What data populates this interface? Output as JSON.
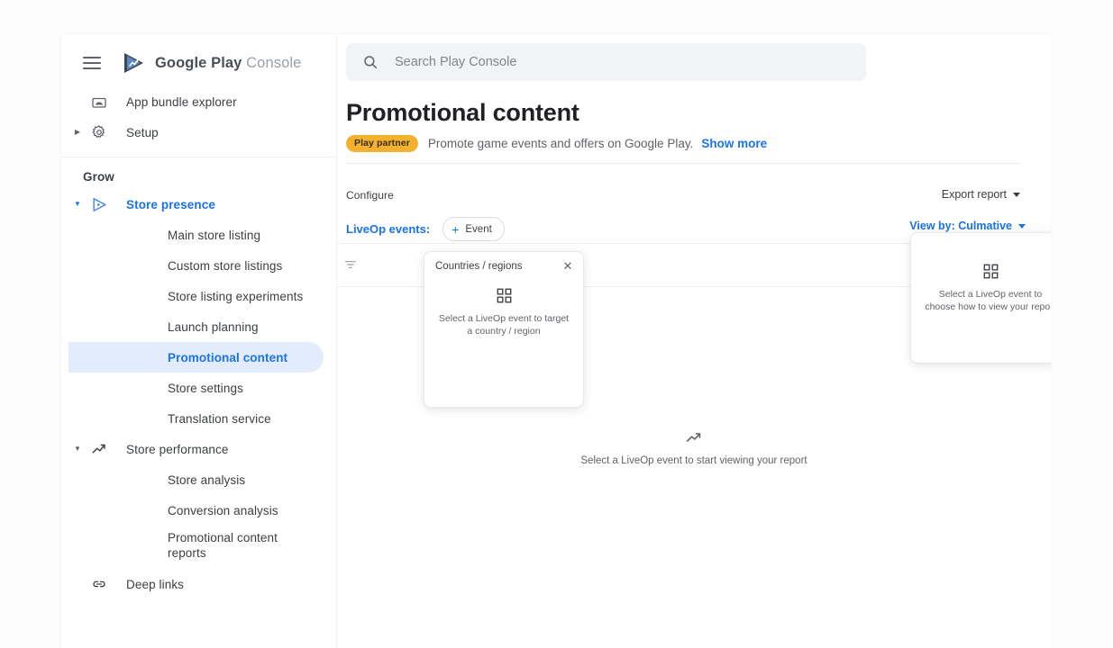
{
  "brand": {
    "name_bold": "Google Play",
    "name_light": "Console",
    "logo_icon": "google-play-console-logo",
    "menu_icon": "hamburger-menu-icon"
  },
  "sidebar": {
    "top_items": [
      {
        "label": "App bundle explorer",
        "icon": "app-bundle-icon",
        "expandable": false
      },
      {
        "label": "Setup",
        "icon": "gear-icon",
        "expandable": true
      }
    ],
    "section_label": "Grow",
    "groups": [
      {
        "label": "Store presence",
        "icon": "play-triangle-icon",
        "expanded": true,
        "highlighted": true,
        "children": [
          {
            "label": "Main store listing",
            "active": false
          },
          {
            "label": "Custom store listings",
            "active": false
          },
          {
            "label": "Store listing experiments",
            "active": false
          },
          {
            "label": "Launch planning",
            "active": false
          },
          {
            "label": "Promotional content",
            "active": true
          },
          {
            "label": "Store settings",
            "active": false
          },
          {
            "label": "Translation service",
            "active": false
          }
        ]
      },
      {
        "label": "Store performance",
        "icon": "trending-up-icon",
        "expanded": true,
        "highlighted": false,
        "children": [
          {
            "label": "Store analysis",
            "active": false
          },
          {
            "label": "Conversion analysis",
            "active": false
          },
          {
            "label": "Promotional content reports",
            "active": false
          }
        ]
      }
    ],
    "bottom_items": [
      {
        "label": "Deep links",
        "icon": "link-icon"
      }
    ]
  },
  "search": {
    "placeholder": "Search Play Console",
    "value": "",
    "icon": "search-icon"
  },
  "header": {
    "title": "Promotional content",
    "badge": "Play partner",
    "description": "Promote game events and offers on Google Play.",
    "show_more": "Show more"
  },
  "toolbar": {
    "configure_label": "Configure",
    "export_report": "Export report",
    "export_icon": "chevron-down-icon",
    "liveop_label": "LiveOp events:",
    "add_event_chip": "Event",
    "add_icon": "plus-icon",
    "view_by": "View by: Culmative",
    "view_by_icon": "chevron-down-icon",
    "filter_icon": "filter-funnel-icon"
  },
  "popovers": {
    "countries": {
      "title": "Countries / regions",
      "close_icon": "close-icon",
      "empty_icon": "grid-2x2-icon",
      "empty_text": "Select a LiveOp event to target a country / region"
    },
    "view_by": {
      "empty_icon": "grid-2x2-icon",
      "empty_text": "Select a LiveOp event to choose how to view your report"
    }
  },
  "empty_state": {
    "icon": "trending-up-icon",
    "text": "Select a LiveOp event to start viewing your report"
  },
  "colors": {
    "accent_blue": "#1a73e8",
    "active_pill": "#e3ecfd",
    "badge_amber": "#f2b230",
    "text_primary": "#3c4043",
    "text_secondary": "#5f6368",
    "search_bg": "#f1f3f4"
  }
}
